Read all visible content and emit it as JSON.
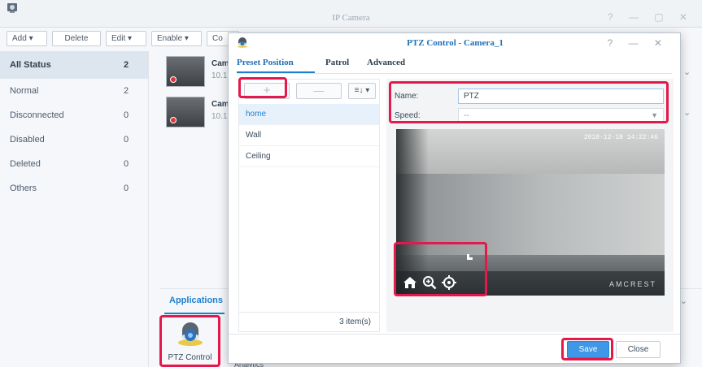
{
  "main": {
    "title": "IP Camera",
    "window_controls": "? — ▢ ✕",
    "toolbar": [
      "Add ▾",
      "Delete",
      "Edit ▾",
      "Enable ▾",
      "Co"
    ],
    "sidebar": [
      {
        "label": "All Status",
        "count": "2"
      },
      {
        "label": "Normal",
        "count": "2"
      },
      {
        "label": "Disconnected",
        "count": "0"
      },
      {
        "label": "Disabled",
        "count": "0"
      },
      {
        "label": "Deleted",
        "count": "0"
      },
      {
        "label": "Others",
        "count": "0"
      }
    ],
    "cameras": [
      {
        "name": "Cam",
        "ip": "10.1"
      },
      {
        "name": "Cam",
        "ip": "10.1"
      }
    ],
    "apps_tab": "Applications",
    "apps": [
      {
        "label": "PTZ Control"
      }
    ],
    "analytics_label": "Analytics"
  },
  "dialog": {
    "title": "PTZ Control - Camera_1",
    "window_controls": "? — ✕",
    "tabs": [
      "Preset Position",
      "Patrol",
      "Advanced"
    ],
    "active_tab": "Preset Position",
    "add_icon": "+",
    "remove_icon": "—",
    "sort_icon": "≡↓ ▾",
    "presets": [
      "home",
      "Wall",
      "Ceiling"
    ],
    "selected_preset": "home",
    "item_count": "3 item(s)",
    "name_label": "Name:",
    "name_value": "PTZ",
    "speed_label": "Speed:",
    "speed_value": "--",
    "video": {
      "timestamp": "2018-12-18 14:22:46",
      "brand": "AMCREST"
    },
    "save_label": "Save",
    "close_label": "Close"
  },
  "colors": {
    "accent": "#1e7fcf",
    "save_button": "#3f97e8",
    "highlight": "#e4184a",
    "record_dot": "#e23434"
  },
  "icons": [
    "camera-app-icon",
    "home-icon",
    "zoom-in-icon",
    "focus-target-icon",
    "diagonal-arrow-icon",
    "ptz-dome-camera-icon"
  ]
}
